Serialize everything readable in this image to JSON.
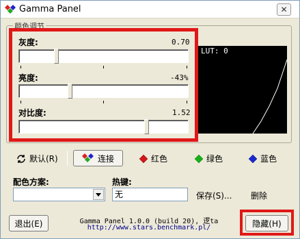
{
  "window": {
    "title": "Gamma Panel",
    "close_glyph": "✕"
  },
  "group": {
    "legend": "颜色调节"
  },
  "brightness": {
    "label": "灰度:",
    "value": "0.70"
  },
  "contrast_level": {
    "label": "亮度:",
    "value": "-43%"
  },
  "contrast": {
    "label": "对比度:",
    "value": "1.52"
  },
  "lut": {
    "label": "LUT: 0"
  },
  "buttons": {
    "default": "默认(R)",
    "link": "连接",
    "red": "红色",
    "green": "绿色",
    "blue": "蓝色",
    "save": "保存(S)...",
    "delete": "删除",
    "exit": "退出(E)",
    "hide": "隐藏(H)"
  },
  "scheme": {
    "label": "配色方案:",
    "value": ""
  },
  "hotkey": {
    "label": "热键:",
    "value": "无"
  },
  "footer": {
    "version": "Gamma Panel 1.0.0 (build 20), 逻ta",
    "url": "http://www.stars.benchmark.pl/"
  },
  "colors": {
    "accent_red": "#e01818",
    "lut_bg": "#000000"
  },
  "icons": {
    "title": "gamma-icon",
    "default": "refresh-icon",
    "link": "rgb-diamonds-icon",
    "red": "red-diamond-icon",
    "green": "green-diamond-icon",
    "blue": "blue-diamond-icon"
  }
}
